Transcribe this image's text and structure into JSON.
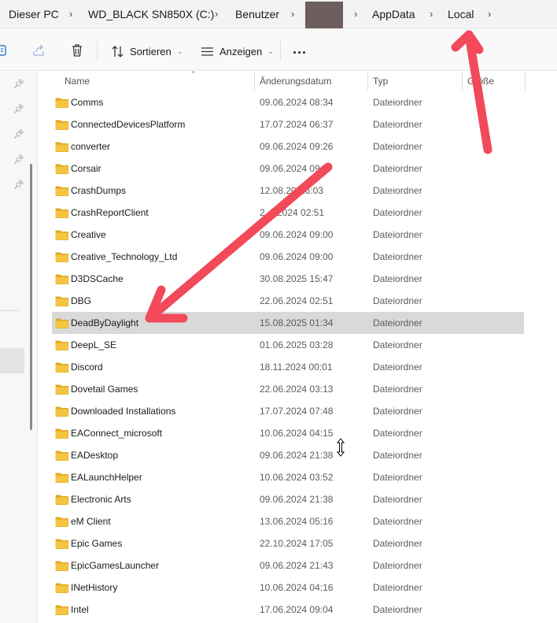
{
  "breadcrumb": {
    "items": [
      "Dieser PC",
      "WD_BLACK SN850X (C:)",
      "Benutzer",
      "AppData",
      "Local"
    ]
  },
  "toolbar": {
    "sort_label": "Sortieren",
    "view_label": "Anzeigen",
    "more_label": "..."
  },
  "columns": {
    "name": "Name",
    "date": "Änderungsdatum",
    "type": "Typ",
    "size": "Größe"
  },
  "files": [
    {
      "name": "Comms",
      "date": "09.06.2024 08:34",
      "type": "Dateiordner"
    },
    {
      "name": "ConnectedDevicesPlatform",
      "date": "17.07.2024 06:37",
      "type": "Dateiordner"
    },
    {
      "name": "converter",
      "date": "09.06.2024 09:26",
      "type": "Dateiordner"
    },
    {
      "name": "Corsair",
      "date": "09.06.2024 09:",
      "type": "Dateiordner"
    },
    {
      "name": "CrashDumps",
      "date": "12.08.20",
      "date2": "16:03",
      "type": "Dateiordner"
    },
    {
      "name": "CrashReportClient",
      "date": "2",
      "date2": "2024 02:51",
      "type": "Dateiordner"
    },
    {
      "name": "Creative",
      "date": "09.06.2024 09:00",
      "type": "Dateiordner"
    },
    {
      "name": "Creative_Technology_Ltd",
      "date": "09.06.2024 09:00",
      "type": "Dateiordner"
    },
    {
      "name": "D3DSCache",
      "date": "30.08.2025 15:47",
      "type": "Dateiordner"
    },
    {
      "name": "DBG",
      "date": "22.06.2024 02:51",
      "type": "Dateiordner"
    },
    {
      "name": "DeadByDaylight",
      "date": "15.08.2025 01:34",
      "type": "Dateiordner",
      "selected": true
    },
    {
      "name": "DeepL_SE",
      "date": "01.06.2025 03:28",
      "type": "Dateiordner"
    },
    {
      "name": "Discord",
      "date": "18.11.2024 00:01",
      "type": "Dateiordner"
    },
    {
      "name": "Dovetail Games",
      "date": "22.06.2024 03:13",
      "type": "Dateiordner"
    },
    {
      "name": "Downloaded Installations",
      "date": "17.07.2024 07:48",
      "type": "Dateiordner"
    },
    {
      "name": "EAConnect_microsoft",
      "date": "10.06.2024 04:15",
      "type": "Dateiordner"
    },
    {
      "name": "EADesktop",
      "date": "09.06.2024 21:38",
      "type": "Dateiordner"
    },
    {
      "name": "EALaunchHelper",
      "date": "10.06.2024 03:52",
      "type": "Dateiordner"
    },
    {
      "name": "Electronic Arts",
      "date": "09.06.2024 21:38",
      "type": "Dateiordner"
    },
    {
      "name": "eM Client",
      "date": "13.06.2024 05:16",
      "type": "Dateiordner"
    },
    {
      "name": "Epic Games",
      "date": "22.10.2024 17:05",
      "type": "Dateiordner"
    },
    {
      "name": "EpicGamesLauncher",
      "date": "09.06.2024 21:43",
      "type": "Dateiordner"
    },
    {
      "name": "INetHistory",
      "date": "10.06.2024 04:16",
      "type": "Dateiordner"
    },
    {
      "name": "Intel",
      "date": "17.06.2024 09:04",
      "type": "Dateiordner"
    }
  ],
  "colors": {
    "folder": "#f4c542",
    "folder_dark": "#e0a81d",
    "annotation_arrow": "#f2495b",
    "selection": "#d9d9d9",
    "redaction": "#6e5e5e"
  },
  "icons": [
    "copy-path-icon",
    "share-icon",
    "trash-icon",
    "sort-icon",
    "view-icon",
    "pin-icon",
    "folder-icon",
    "resize-cursor-icon"
  ]
}
